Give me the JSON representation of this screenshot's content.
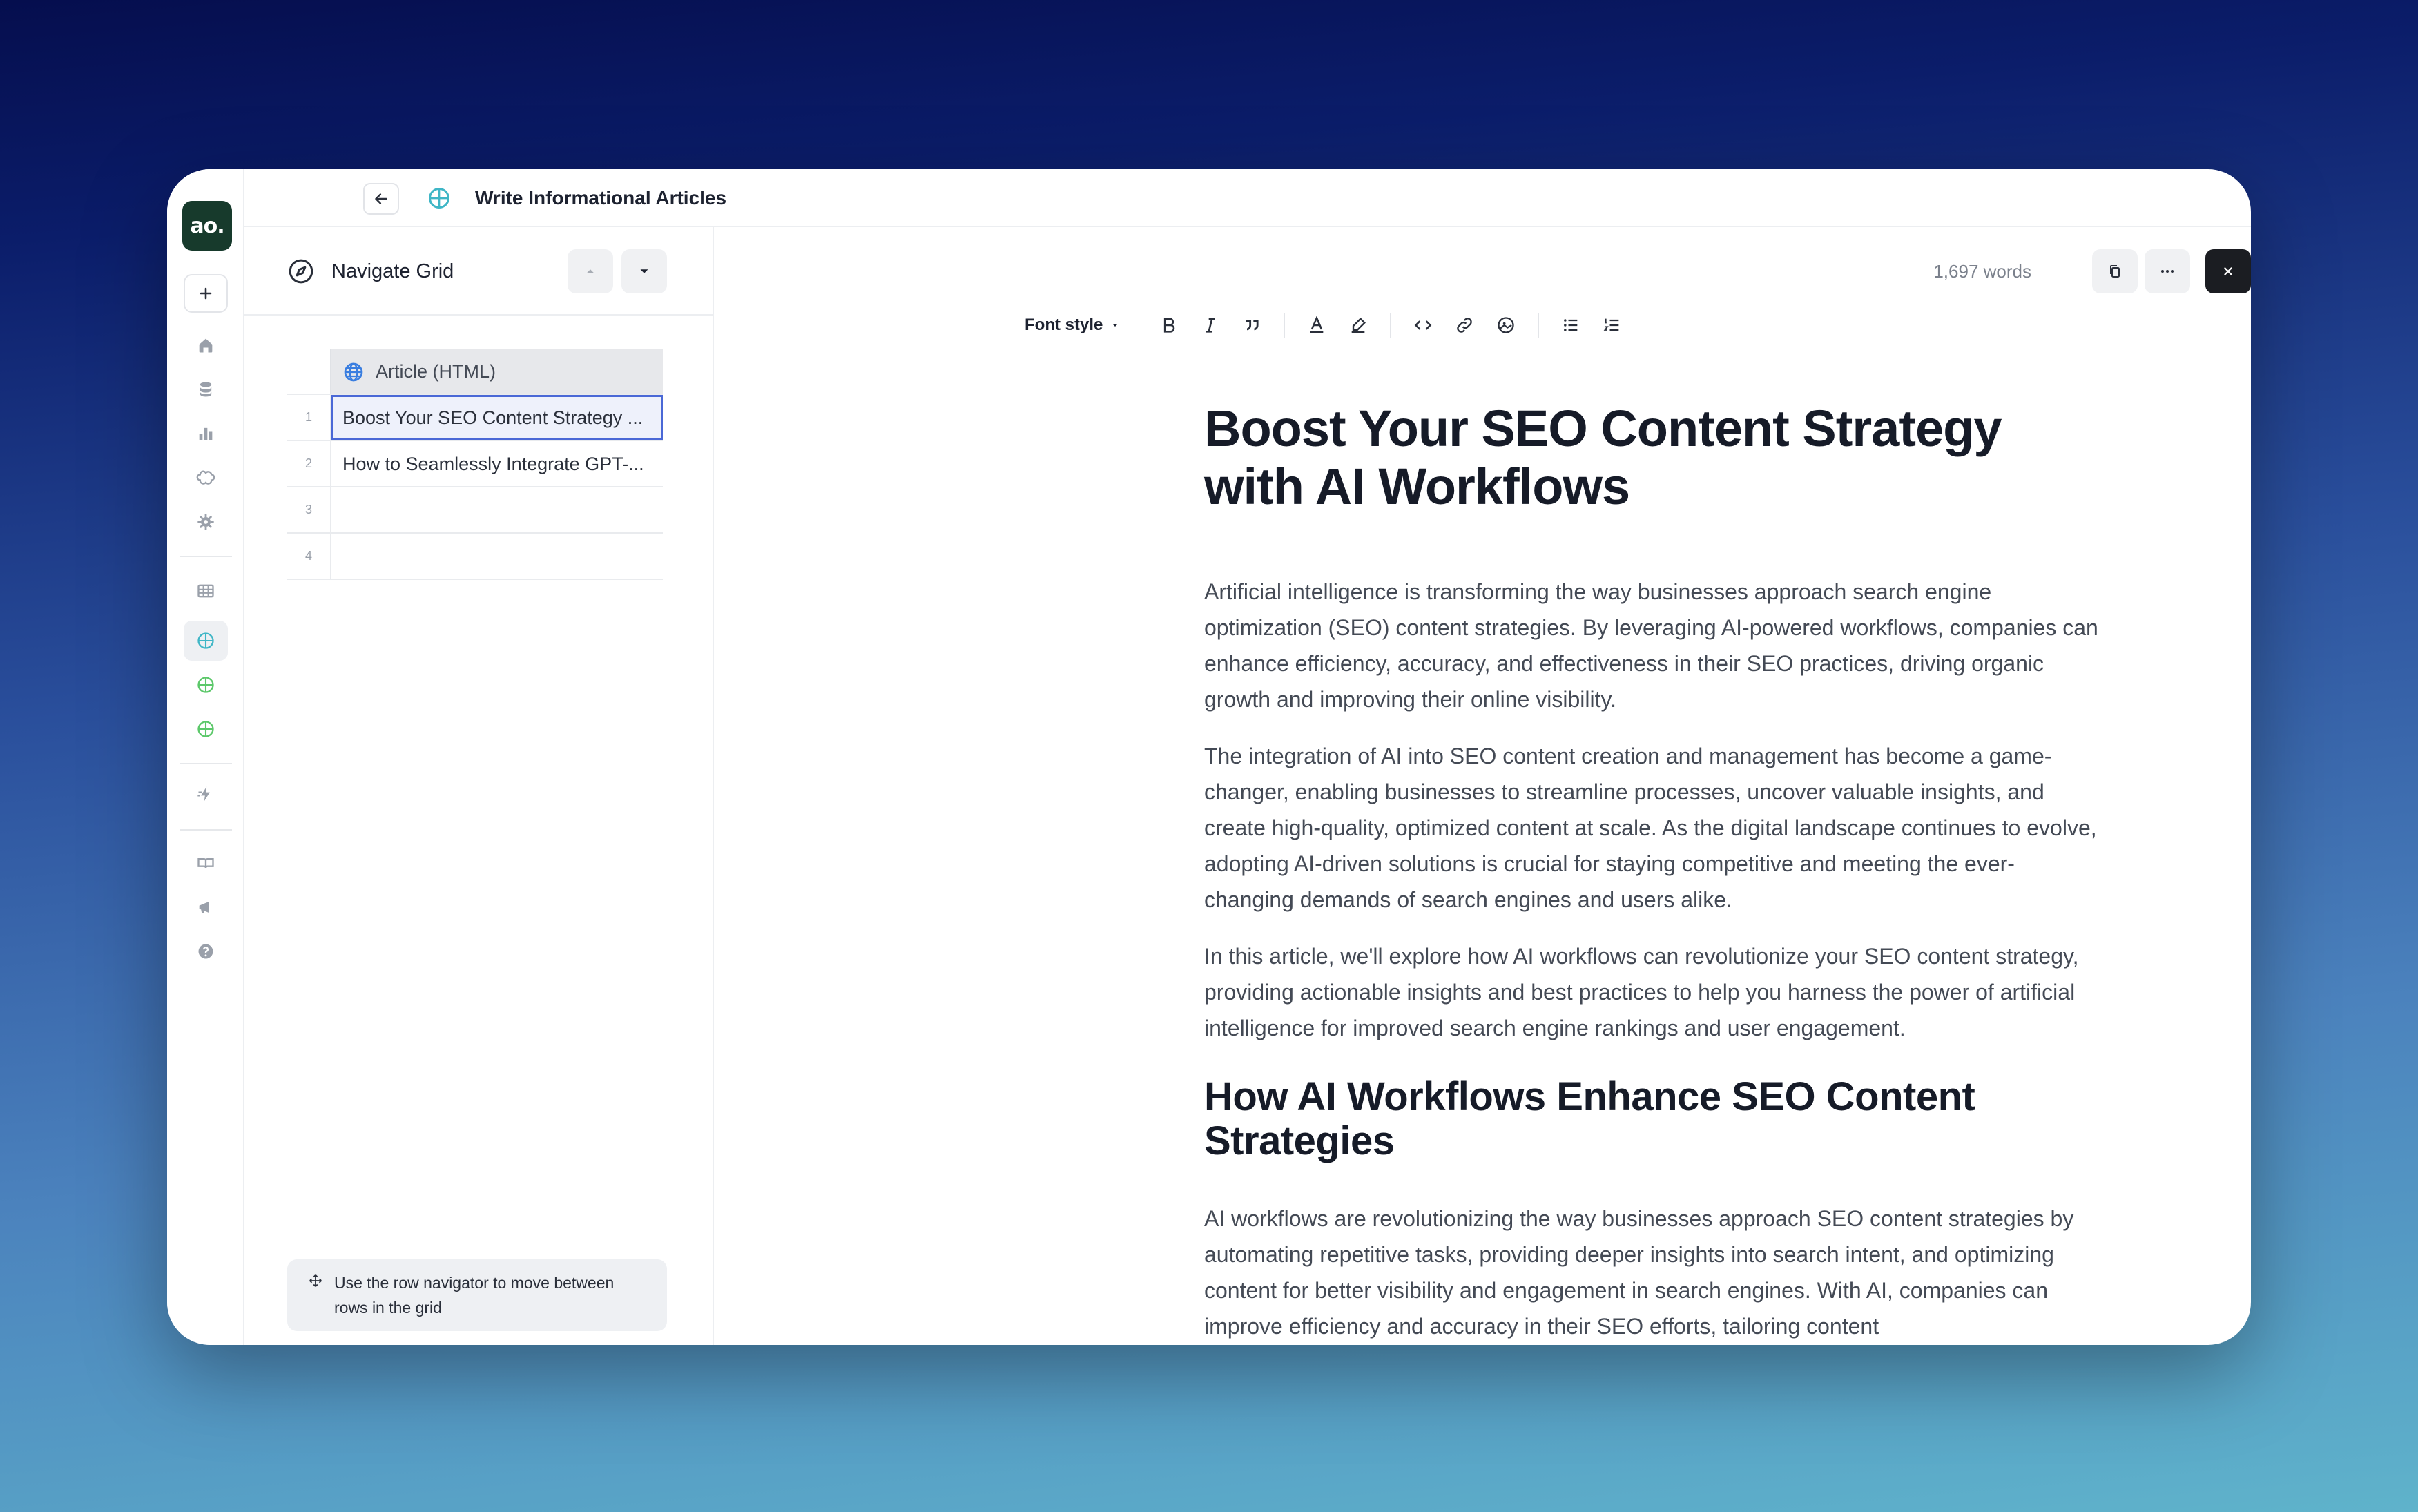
{
  "app": {
    "logo_text": "ao.",
    "title": "Write Informational Articles"
  },
  "rail": {
    "icons": [
      "plus-icon",
      "home-icon",
      "database-icon",
      "chart-icon",
      "brain-icon",
      "gear-icon",
      "table-icon",
      "grid-icon-active",
      "grid-icon-green",
      "grid-icon-green-2",
      "lightning-icon",
      "book-icon",
      "megaphone-icon",
      "help-icon"
    ]
  },
  "navigator": {
    "title": "Navigate Grid",
    "column_header": "Article (HTML)",
    "rows": [
      {
        "num": "1",
        "value": "Boost Your SEO Content Strategy ..."
      },
      {
        "num": "2",
        "value": "How to Seamlessly Integrate GPT-..."
      },
      {
        "num": "3",
        "value": ""
      },
      {
        "num": "4",
        "value": ""
      }
    ],
    "hint": "Use the row navigator to move between rows in the grid"
  },
  "editor": {
    "word_count": "1,697 words",
    "font_style_label": "Font style",
    "colors": {
      "accent": "#4a68d6",
      "logo_bg": "#173a2c"
    }
  },
  "article": {
    "title": "Boost Your SEO Content Strategy with AI Workflows",
    "paragraphs": [
      "Artificial intelligence is transforming the way businesses approach search engine optimization (SEO) content strategies. By leveraging AI-powered workflows, companies can enhance efficiency, accuracy, and effectiveness in their SEO practices, driving organic growth and improving their online visibility.",
      "The integration of AI into SEO content creation and management has become a game-changer, enabling businesses to streamline processes, uncover valuable insights, and create high-quality, optimized content at scale. As the digital landscape continues to evolve, adopting AI-driven solutions is crucial for staying competitive and meeting the ever-changing demands of search engines and users alike.",
      "In this article, we'll explore how AI workflows can revolutionize your SEO content strategy, providing actionable insights and best practices to help you harness the power of artificial intelligence for improved search engine rankings and user engagement."
    ],
    "h2": "How AI Workflows Enhance SEO Content Strategies",
    "paragraph_after_h2": "AI workflows are revolutionizing the way businesses approach SEO content strategies by automating repetitive tasks, providing deeper insights into search intent, and optimizing content for better visibility and engagement in search engines. With AI, companies can improve efficiency and accuracy in their SEO efforts, tailoring content"
  }
}
